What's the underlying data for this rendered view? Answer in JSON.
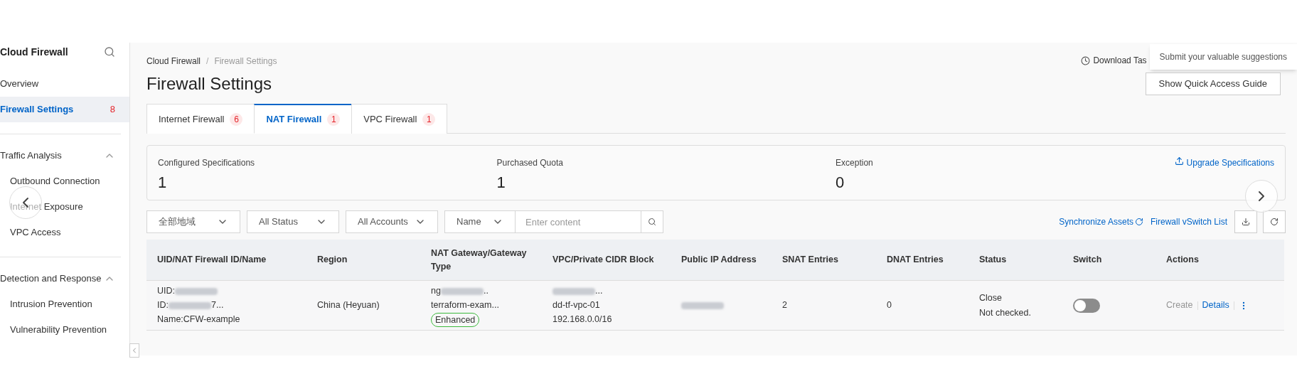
{
  "sidebar": {
    "title": "Cloud Firewall",
    "items": [
      {
        "label": "Overview",
        "selected": false
      },
      {
        "label": "Firewall Settings",
        "selected": true,
        "badge": "8"
      }
    ],
    "groups": [
      {
        "label": "Traffic Analysis",
        "expanded": true,
        "items": [
          {
            "label": "Outbound Connection",
            "selected": false
          },
          {
            "label": "Internet Exposure",
            "selected": false
          },
          {
            "label": "VPC Access",
            "selected": false
          }
        ]
      },
      {
        "label": "Detection and Response",
        "expanded": true,
        "items": [
          {
            "label": "Intrusion Prevention",
            "selected": false
          },
          {
            "label": "Vulnerability Prevention",
            "selected": false
          }
        ]
      }
    ]
  },
  "breadcrumb": [
    "Cloud Firewall",
    "Firewall Settings"
  ],
  "breadcrumb_separator": "/",
  "title": "Firewall Settings",
  "download_tasks": "Download Tas",
  "tooltip": "Submit your valuable suggestions",
  "guide_button": "Show Quick Access Guide",
  "tabs": [
    {
      "label": "Internet Firewall",
      "badge": "6",
      "selected": false
    },
    {
      "label": "NAT Firewall",
      "badge": "1",
      "selected": true
    },
    {
      "label": "VPC Firewall",
      "badge": "1",
      "selected": false
    }
  ],
  "stats": [
    {
      "label": "Configured Specifications",
      "value": "1"
    },
    {
      "label": "Purchased Quota",
      "value": "1"
    },
    {
      "label": "Exception",
      "value": "0"
    }
  ],
  "upgrade_link": "Upgrade Specifications",
  "filters": {
    "region": "全部地域",
    "status": "All Status",
    "accounts": "All Accounts",
    "field": "Name",
    "search": {
      "placeholder": "Enter content"
    }
  },
  "links": [
    "Synchronize Assets",
    "Firewall vSwitch List"
  ],
  "table": {
    "columns": [
      "UID/NAT Firewall ID/Name",
      "Region",
      "NAT Gateway/Gateway Type",
      "VPC/Private CIDR Block",
      "Public IP Address",
      "SNAT Entries",
      "DNAT Entries",
      "Status",
      "Switch",
      "Actions"
    ],
    "rows": [
      {
        "firewall": [
          {
            "text": "UID:",
            "redacted": true
          },
          {
            "text": "ID:",
            "redacted": true,
            "suffix": "7..."
          },
          {
            "text": "Name:CFW-example",
            "redacted": false
          }
        ],
        "region": "China (Heyuan)",
        "gateway": [
          {
            "text": "ng",
            "redacted": true,
            "suffix": ".."
          },
          {
            "text": "terraform-exam...",
            "redacted": false
          }
        ],
        "gateway_type": "Enhanced",
        "vpc": [
          {
            "redacted": true,
            "suffix": "..."
          },
          {
            "text": "dd-tf-vpc-01",
            "redacted": false
          },
          {
            "text": "192.168.0.0/16",
            "redacted": false
          }
        ],
        "public_ip": [
          {
            "redacted": true
          }
        ],
        "snat": "2",
        "dnat": "0",
        "status": [
          "Close",
          "Not checked."
        ],
        "switch": {
          "on": false
        },
        "actions": [
          {
            "label": "Create",
            "disabled": true
          },
          {
            "label": "Details",
            "disabled": false
          }
        ]
      }
    ]
  }
}
